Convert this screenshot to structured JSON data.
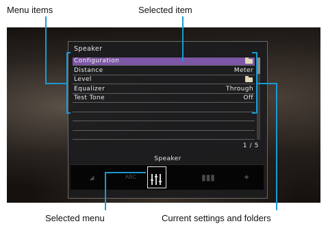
{
  "callouts": {
    "menu_items": "Menu items",
    "selected_item": "Selected item",
    "selected_menu": "Selected menu",
    "current_settings": "Current settings and folders"
  },
  "panel": {
    "title": "Speaker",
    "rows": [
      {
        "label": "Configuration",
        "value": "",
        "icon": "folder-icon",
        "selected": true
      },
      {
        "label": "Distance",
        "value": "Meter",
        "icon": "",
        "selected": false
      },
      {
        "label": "Level",
        "value": "",
        "icon": "folder-icon",
        "selected": false
      },
      {
        "label": "Equalizer",
        "value": "Through",
        "icon": "",
        "selected": false
      },
      {
        "label": "Test Tone",
        "value": "Off",
        "icon": "",
        "selected": false
      },
      {
        "label": "",
        "value": "",
        "icon": "",
        "selected": false
      },
      {
        "label": "",
        "value": "",
        "icon": "",
        "selected": false
      },
      {
        "label": "",
        "value": "",
        "icon": "",
        "selected": false
      },
      {
        "label": "",
        "value": "",
        "icon": "",
        "selected": false
      }
    ],
    "page": "1 / 5",
    "menu_label": "Speaker",
    "menu_icons": [
      "speaker-menu-icon",
      "abc-menu-icon",
      "speaker-eq-menu-icon",
      "bars-menu-icon",
      "dsp-menu-icon"
    ],
    "menu_abc_text": "ABC"
  },
  "colors": {
    "selection": "#7d57a6",
    "callout_line": "#1a9ad6"
  }
}
